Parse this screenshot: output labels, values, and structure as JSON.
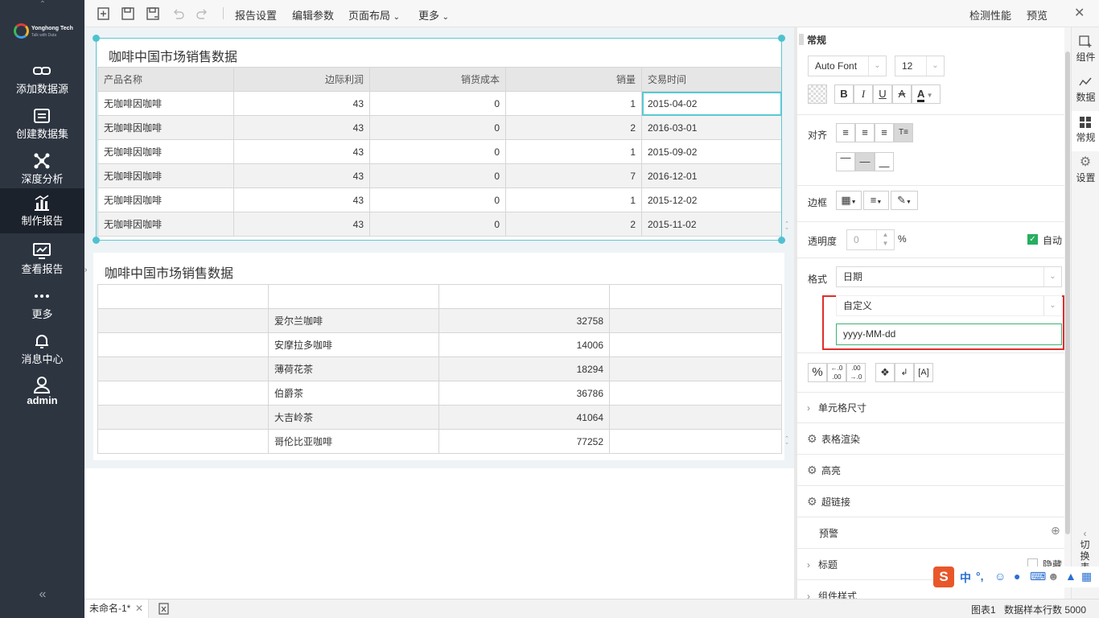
{
  "nav": {
    "brand": "Yonghong Tech",
    "slogan": "Talk with Data",
    "items": [
      {
        "label": "添加数据源",
        "icon": "link-icon"
      },
      {
        "label": "创建数据集",
        "icon": "list-icon"
      },
      {
        "label": "深度分析",
        "icon": "network-icon"
      },
      {
        "label": "制作报告",
        "icon": "chart-icon",
        "active": true
      },
      {
        "label": "查看报告",
        "icon": "monitor-icon"
      },
      {
        "label": "更多",
        "icon": "more-icon"
      },
      {
        "label": "消息中心",
        "icon": "bell-icon"
      },
      {
        "label": "admin",
        "icon": "user-icon"
      }
    ]
  },
  "toolbar": {
    "report_settings": "报告设置",
    "edit_params": "编辑参数",
    "page_layout": "页面布局",
    "more": "更多",
    "check_perf": "检测性能",
    "preview": "预览"
  },
  "table1": {
    "title": "咖啡中国市场销售数据",
    "columns": [
      "产品名称",
      "边际利润",
      "销货成本",
      "销量",
      "交易时间"
    ],
    "rows": [
      [
        "无咖啡因咖啡",
        "43",
        "0",
        "1",
        "2015-04-02"
      ],
      [
        "无咖啡因咖啡",
        "43",
        "0",
        "2",
        "2016-03-01"
      ],
      [
        "无咖啡因咖啡",
        "43",
        "0",
        "1",
        "2015-09-02"
      ],
      [
        "无咖啡因咖啡",
        "43",
        "0",
        "7",
        "2016-12-01"
      ],
      [
        "无咖啡因咖啡",
        "43",
        "0",
        "1",
        "2015-12-02"
      ],
      [
        "无咖啡因咖啡",
        "43",
        "0",
        "2",
        "2015-11-02"
      ]
    ]
  },
  "table2": {
    "title": "咖啡中国市场销售数据",
    "rows": [
      [
        "",
        "爱尔兰咖啡",
        "32758",
        ""
      ],
      [
        "",
        "安摩拉多咖啡",
        "14006",
        ""
      ],
      [
        "",
        "薄荷花茶",
        "18294",
        ""
      ],
      [
        "",
        "伯爵茶",
        "36786",
        ""
      ],
      [
        "",
        "大吉岭茶",
        "41064",
        ""
      ],
      [
        "",
        "哥伦比亚咖啡",
        "77252",
        ""
      ]
    ]
  },
  "panel": {
    "header": "常规",
    "font": "Auto Font",
    "size": "12",
    "align_label": "对齐",
    "border_label": "边框",
    "opacity_label": "透明度",
    "opacity_value": "0",
    "percent": "%",
    "auto_label": "自动",
    "format_label": "格式",
    "format_value": "日期",
    "format_type": "自定义",
    "format_pattern": "yyyy-MM-dd",
    "sections": {
      "cell_size": "单元格尺寸",
      "table_render": "表格渲染",
      "highlight": "高亮",
      "hyperlink": "超链接",
      "warning": "预警",
      "title": "标题",
      "hide": "隐藏",
      "component_style": "组件样式"
    }
  },
  "rtabs": {
    "component": "组件",
    "data": "数据",
    "general": "常规",
    "settings": "设置",
    "switch": [
      "切",
      "换",
      "表"
    ]
  },
  "status": {
    "tab_name": "未命名-1*",
    "chart_name": "图表1",
    "sample_rows": "数据样本行数 5000"
  },
  "ime": {
    "logo": "S",
    "lang": "中"
  }
}
